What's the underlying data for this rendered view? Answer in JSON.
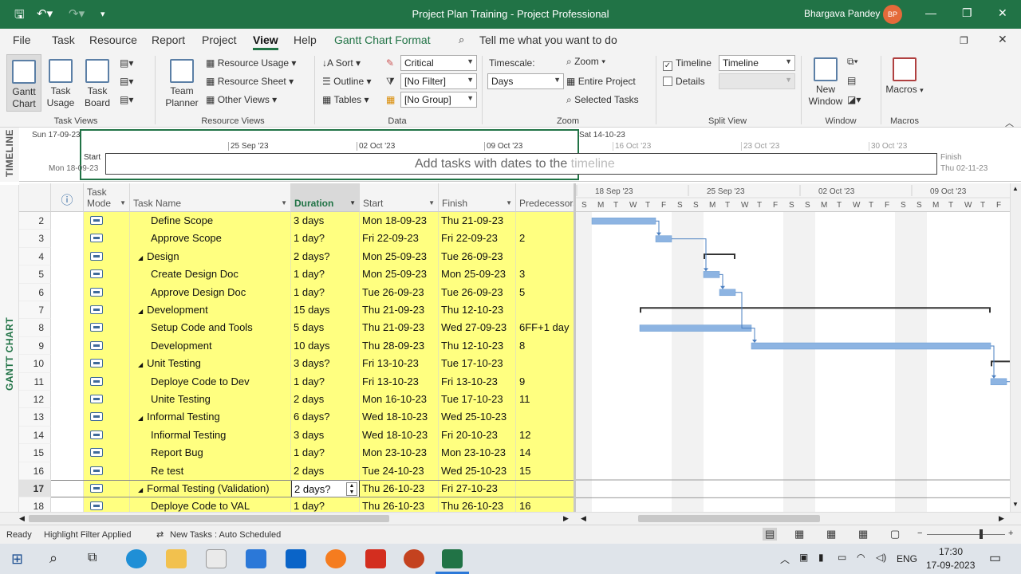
{
  "titlebar": {
    "title": "Project Plan Training  -  Project Professional",
    "user": "Bhargava Pandey",
    "initials": "BP"
  },
  "menu": [
    "File",
    "Task",
    "Resource",
    "Report",
    "Project",
    "View",
    "Help",
    "Gantt Chart Format"
  ],
  "search": {
    "placeholder": "Tell me what you want to do"
  },
  "ribbon": {
    "task_views": {
      "gantt": "Gantt\nChart",
      "task_usage": "Task\nUsage",
      "task_board": "Task\nBoard",
      "label": "Task Views"
    },
    "resource_views": {
      "team_planner": "Team\nPlanner",
      "resource_usage": "Resource Usage",
      "resource_sheet": "Resource Sheet",
      "other_views": "Other Views",
      "label": "Resource Views"
    },
    "data": {
      "sort": "Sort",
      "outline": "Outline",
      "tables": "Tables",
      "highlight": "Critical",
      "filter": "[No Filter]",
      "group": "[No Group]",
      "label": "Data"
    },
    "zoom": {
      "timescale_label": "Timescale:",
      "timescale": "Days",
      "zoom": "Zoom",
      "entire_project": "Entire Project",
      "selected_tasks": "Selected Tasks",
      "label": "Zoom"
    },
    "split_view": {
      "timeline_chk": "Timeline",
      "timeline_sel": "Timeline",
      "details_chk": "Details",
      "label": "Split View"
    },
    "window": {
      "new_window": "New\nWindow",
      "label": "Window"
    },
    "macros": {
      "macros": "Macros",
      "label": "Macros"
    }
  },
  "timeline": {
    "side_label": "TIMELINE",
    "start_top": "Sun 17-09-23",
    "dates": [
      "25 Sep '23",
      "02 Oct '23",
      "09 Oct '23",
      "16 Oct '23",
      "23 Oct '23",
      "30 Oct '23"
    ],
    "right_top": "Sat 14-10-23",
    "start_label": "Start",
    "start_date": "Mon 18-09-23",
    "finish_label": "Finish",
    "finish_date": "Thu 02-11-23",
    "placeholder_dark": "Add tasks with dates to the",
    "placeholder_light": "timeline"
  },
  "grid": {
    "side_label": "GANTT CHART",
    "headers": {
      "info": "ⓘ",
      "mode": "Task\nMode",
      "name": "Task Name",
      "duration": "Duration",
      "start": "Start",
      "finish": "Finish",
      "pred": "Predecessors"
    },
    "rows": [
      {
        "id": "2",
        "name": "Define Scope",
        "summary": false,
        "duration": "3 days",
        "start": "Mon 18-09-23",
        "finish": "Thu 21-09-23",
        "pred": ""
      },
      {
        "id": "3",
        "name": "Approve Scope",
        "summary": false,
        "duration": "1 day?",
        "start": "Fri 22-09-23",
        "finish": "Fri 22-09-23",
        "pred": "2"
      },
      {
        "id": "4",
        "name": "Design",
        "summary": true,
        "duration": "2 days?",
        "start": "Mon 25-09-23",
        "finish": "Tue 26-09-23",
        "pred": ""
      },
      {
        "id": "5",
        "name": "Create Design Doc",
        "summary": false,
        "duration": "1 day?",
        "start": "Mon 25-09-23",
        "finish": "Mon 25-09-23",
        "pred": "3"
      },
      {
        "id": "6",
        "name": "Approve Design Doc",
        "summary": false,
        "duration": "1 day?",
        "start": "Tue 26-09-23",
        "finish": "Tue 26-09-23",
        "pred": "5"
      },
      {
        "id": "7",
        "name": "Development",
        "summary": true,
        "duration": "15 days",
        "start": "Thu 21-09-23",
        "finish": "Thu 12-10-23",
        "pred": ""
      },
      {
        "id": "8",
        "name": "Setup Code and Tools",
        "summary": false,
        "duration": "5 days",
        "start": "Thu 21-09-23",
        "finish": "Wed 27-09-23",
        "pred": "6FF+1 day"
      },
      {
        "id": "9",
        "name": "Development",
        "summary": false,
        "duration": "10 days",
        "start": "Thu 28-09-23",
        "finish": "Thu 12-10-23",
        "pred": "8"
      },
      {
        "id": "10",
        "name": "Unit Testing",
        "summary": true,
        "duration": "3 days?",
        "start": "Fri 13-10-23",
        "finish": "Tue 17-10-23",
        "pred": ""
      },
      {
        "id": "11",
        "name": "Deploye Code to Dev",
        "summary": false,
        "duration": "1 day?",
        "start": "Fri 13-10-23",
        "finish": "Fri 13-10-23",
        "pred": "9"
      },
      {
        "id": "12",
        "name": "Unite Testing",
        "summary": false,
        "duration": "2 days",
        "start": "Mon 16-10-23",
        "finish": "Tue 17-10-23",
        "pred": "11"
      },
      {
        "id": "13",
        "name": "Informal Testing",
        "summary": true,
        "duration": "6 days?",
        "start": "Wed 18-10-23",
        "finish": "Wed 25-10-23",
        "pred": ""
      },
      {
        "id": "14",
        "name": "Infiormal Testing",
        "summary": false,
        "duration": "3 days",
        "start": "Wed 18-10-23",
        "finish": "Fri 20-10-23",
        "pred": "12"
      },
      {
        "id": "15",
        "name": "Report Bug",
        "summary": false,
        "duration": "1 day?",
        "start": "Mon 23-10-23",
        "finish": "Mon 23-10-23",
        "pred": "14"
      },
      {
        "id": "16",
        "name": "Re test",
        "summary": false,
        "duration": "2 days",
        "start": "Tue 24-10-23",
        "finish": "Wed 25-10-23",
        "pred": "15"
      },
      {
        "id": "17",
        "name": "Formal Testing (Validation)",
        "summary": true,
        "duration": "2 days?",
        "start": "Thu 26-10-23",
        "finish": "Fri 27-10-23",
        "pred": ""
      },
      {
        "id": "18",
        "name": "Deploye Code to VAL",
        "summary": false,
        "duration": "1 day?",
        "start": "Thu 26-10-23",
        "finish": "Thu 26-10-23",
        "pred": "16"
      }
    ]
  },
  "gantt": {
    "weeks": [
      "18 Sep '23",
      "25 Sep '23",
      "02 Oct '23",
      "09 Oct '23"
    ],
    "days": [
      "S",
      "M",
      "T",
      "W",
      "T",
      "F",
      "S",
      "S",
      "M",
      "T",
      "W",
      "T",
      "F",
      "S",
      "S",
      "M",
      "T",
      "W",
      "T",
      "F",
      "S",
      "S",
      "M",
      "T",
      "W",
      "T",
      "F"
    ]
  },
  "status": {
    "ready": "Ready",
    "filter": "Highlight Filter Applied",
    "new_tasks": "New Tasks : Auto Scheduled"
  },
  "taskbar": {
    "lang": "ENG",
    "time": "17:30",
    "date": "17-09-2023"
  },
  "colors": {
    "brand": "#217346",
    "highlight": "#ffff80",
    "bar": "#8db4e2"
  }
}
